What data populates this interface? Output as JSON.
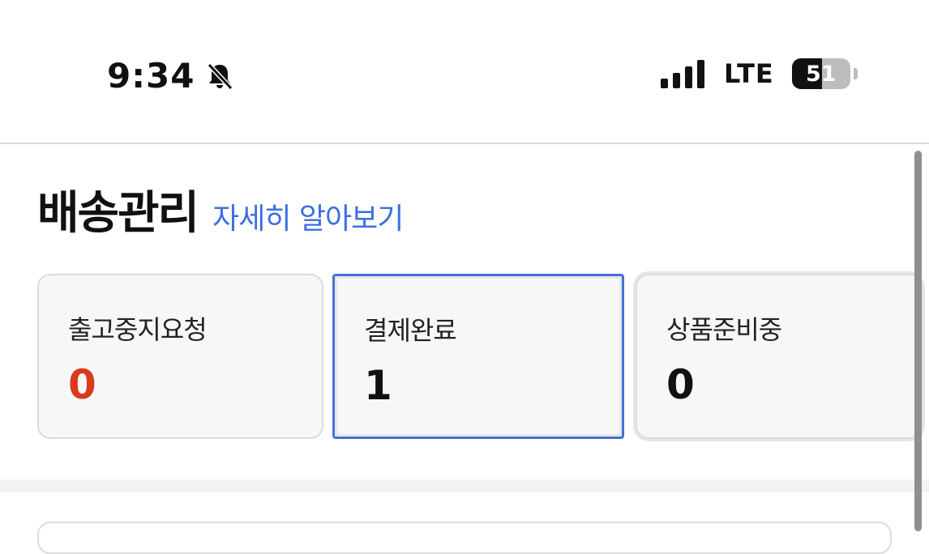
{
  "status_bar": {
    "time": "9:34",
    "network": "LTE",
    "battery_level": "51",
    "battery_fraction": 0.51,
    "silent_icon": "bell-slash-icon",
    "signal_icon": "cellular-signal-icon"
  },
  "section": {
    "title": "배송관리",
    "learn_more": "자세히 알아보기"
  },
  "cards": [
    {
      "label": "출고중지요청",
      "count": "0"
    },
    {
      "label": "결제완료",
      "count": "1"
    },
    {
      "label": "상품준비중",
      "count": "0"
    }
  ],
  "colors": {
    "accent": "#3c6fe0",
    "alert": "#d93a1e",
    "selected_border": "#4470d6"
  }
}
